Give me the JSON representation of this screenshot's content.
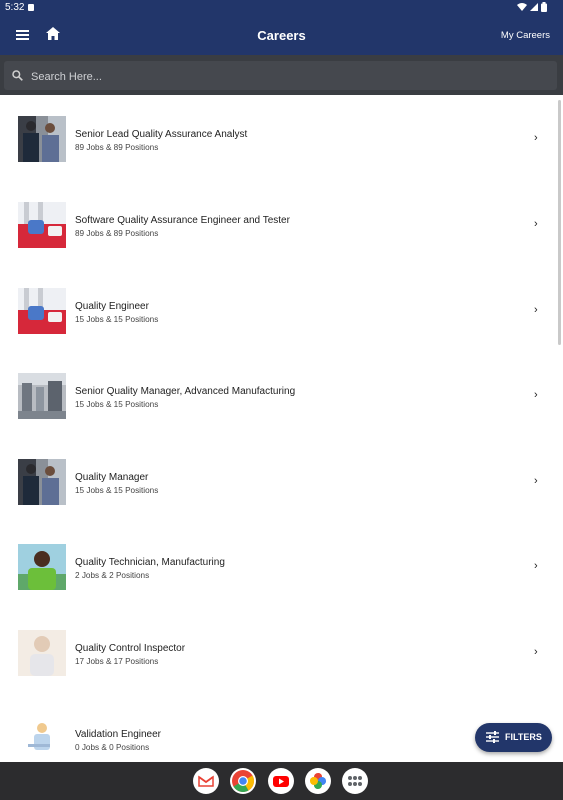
{
  "status_bar": {
    "time": "5:32"
  },
  "header": {
    "title": "Careers",
    "my_careers_label": "My Careers"
  },
  "search": {
    "placeholder": "Search Here..."
  },
  "careers": [
    {
      "title": "Senior Lead Quality Assurance Analyst",
      "subtitle": "89 Jobs & 89 Positions",
      "image": "people-in-lab"
    },
    {
      "title": "Software Quality Assurance Engineer and Tester",
      "subtitle": "89 Jobs & 89 Positions",
      "image": "gloved-hands-lab"
    },
    {
      "title": "Quality Engineer",
      "subtitle": "15 Jobs & 15 Positions",
      "image": "gloved-hands-lab"
    },
    {
      "title": "Senior Quality Manager, Advanced Manufacturing",
      "subtitle": "15 Jobs & 15 Positions",
      "image": "factory-machinery"
    },
    {
      "title": "Quality Manager",
      "subtitle": "15 Jobs & 15 Positions",
      "image": "people-in-lab"
    },
    {
      "title": "Quality Technician, Manufacturing",
      "subtitle": "2 Jobs & 2 Positions",
      "image": "smiling-man"
    },
    {
      "title": "Quality Control Inspector",
      "subtitle": "17 Jobs & 17 Positions",
      "image": "woman-portrait"
    },
    {
      "title": "Validation Engineer",
      "subtitle": "0 Jobs & 0 Positions",
      "image": "engineer-with-laptop"
    }
  ],
  "filters_button": {
    "label": "FILTERS"
  },
  "dock": [
    "gmail-icon",
    "chrome-icon",
    "youtube-icon",
    "photos-icon",
    "app-drawer-icon"
  ],
  "colors": {
    "app_bar": "#22366a",
    "search_bar": "#3a3d42",
    "nav_bar": "#2c2c2e"
  }
}
